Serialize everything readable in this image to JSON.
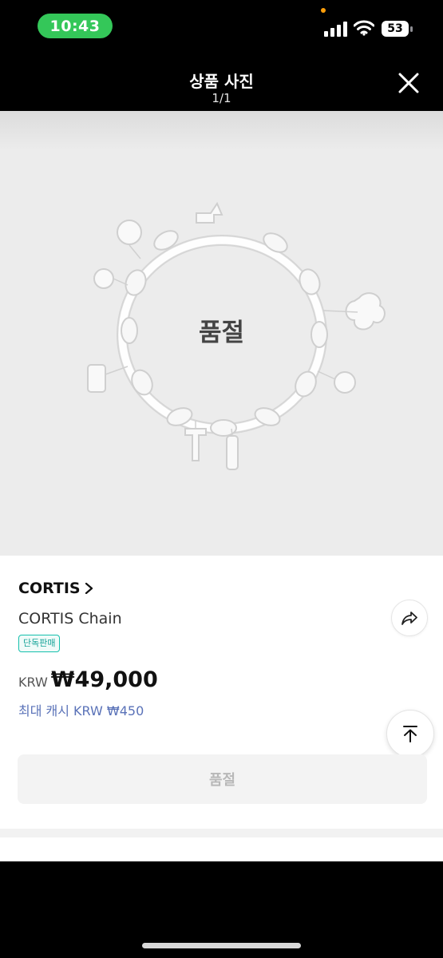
{
  "status": {
    "time": "10:43",
    "battery": "53"
  },
  "header": {
    "title": "상품 사진",
    "counter": "1/1"
  },
  "photo": {
    "overlay_label": "품절"
  },
  "product": {
    "brand": "CORTIS",
    "name": "CORTIS Chain",
    "badge": "단독판매",
    "currency": "KRW",
    "price": "₩49,000",
    "cash_reward": "최대 캐시 KRW ₩450",
    "soldout_button": "품절"
  },
  "colors": {
    "accent_green": "#34c759",
    "badge_teal": "#16a398",
    "cash_blue": "#5a72b8"
  },
  "icons": [
    "signal-icon",
    "wifi-icon",
    "battery-icon",
    "close-icon",
    "chevron-right-icon",
    "share-icon",
    "arrow-up-icon"
  ]
}
